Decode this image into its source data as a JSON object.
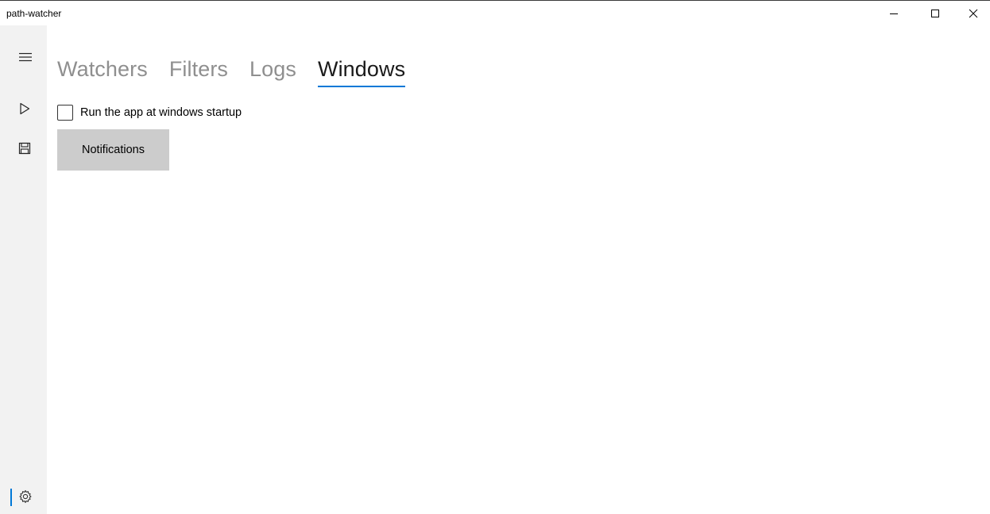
{
  "window": {
    "title": "path-watcher"
  },
  "caption_buttons": {
    "minimize_icon": "minimize-icon",
    "maximize_icon": "maximize-icon",
    "close_icon": "close-icon"
  },
  "rail": {
    "items": [
      {
        "icon": "hamburger-menu-icon"
      },
      {
        "icon": "play-icon"
      },
      {
        "icon": "save-icon"
      },
      {
        "icon": "gear-icon",
        "selected": true
      }
    ]
  },
  "tabs": [
    {
      "label": "Watchers",
      "active": false
    },
    {
      "label": "Filters",
      "active": false
    },
    {
      "label": "Logs",
      "active": false
    },
    {
      "label": "Windows",
      "active": true
    }
  ],
  "settings": {
    "startup_checkbox_label": "Run the app at windows startup",
    "startup_checked": false,
    "notifications_button_label": "Notifications"
  },
  "colors": {
    "accent": "#0078d7",
    "rail_background": "#f2f2f2",
    "button_background": "#cccccc",
    "inactive_tab": "#8f8f8f"
  }
}
